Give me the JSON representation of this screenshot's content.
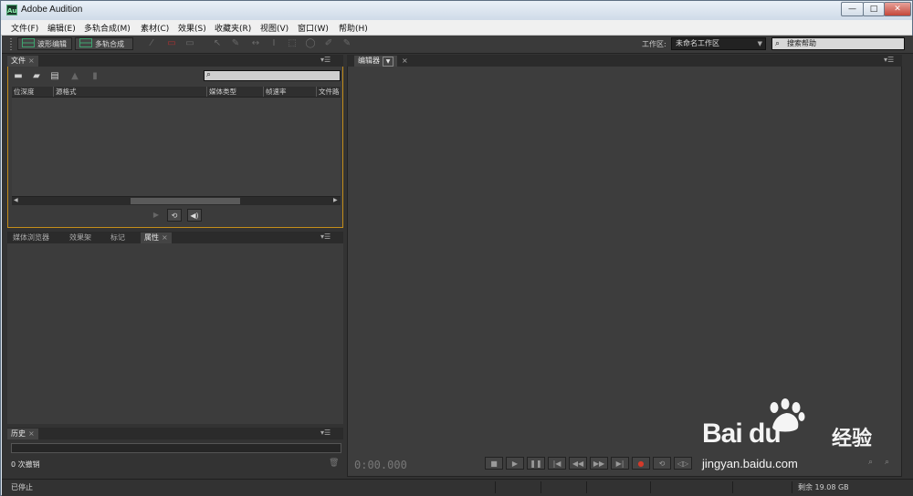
{
  "window": {
    "logo_text": "Au",
    "title": "Adobe Audition",
    "minimize": "—",
    "maximize": "□",
    "close": "✕"
  },
  "menu": [
    "文件(F)",
    "编辑(E)",
    "多轨合成(M)",
    "素材(C)",
    "效果(S)",
    "收藏夹(R)",
    "视图(V)",
    "窗口(W)",
    "帮助(H)"
  ],
  "toolbar": {
    "waveform_label": "波形编辑",
    "multitrack_label": "多轨合成",
    "workspace_label": "工作区:",
    "workspace_value": "未命名工作区",
    "help_search_placeholder": "搜索帮助"
  },
  "files_panel": {
    "tab": "文件",
    "columns": [
      "位深度",
      "源格式",
      "媒体类型",
      "帧速率",
      "文件路"
    ]
  },
  "lower_panel": {
    "tabs": [
      "媒体浏览器",
      "效果架",
      "标记",
      "属性"
    ],
    "active_tab": "属性"
  },
  "history_panel": {
    "tab": "历史",
    "undo_count": "0 次撤销"
  },
  "editor_panel": {
    "tab": "编辑器",
    "timecode": "0:00.000"
  },
  "status": {
    "state": "已停止",
    "free_space": "剩余 19.08 GB"
  },
  "watermark": {
    "brand": "Bai du",
    "brand_cn": "经验",
    "url": "jingyan.baidu.com"
  },
  "colors": {
    "accent_panel_border": "#c48d1a",
    "record": "#d43a2a",
    "mode_icon": "#3fa36f"
  }
}
